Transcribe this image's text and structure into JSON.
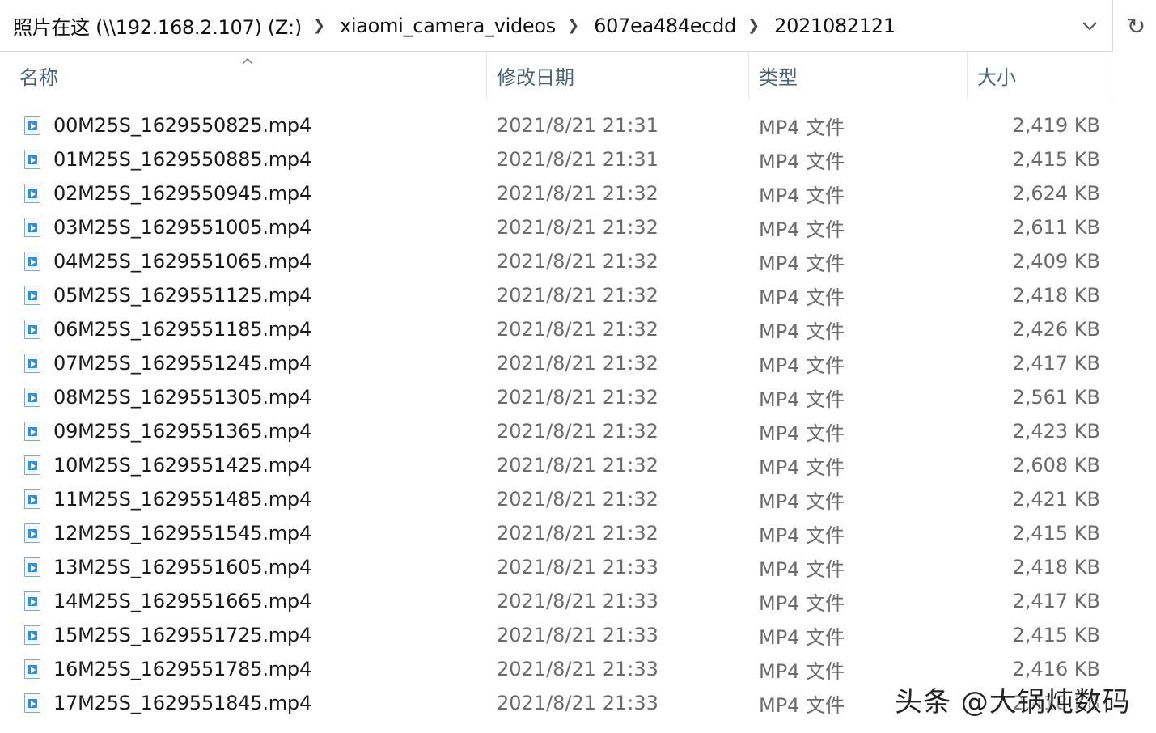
{
  "address_bar": {
    "breadcrumbs": [
      "照片在这 (\\\\192.168.2.107) (Z:)",
      "xiaomi_camera_videos",
      "607ea484ecdd",
      "2021082121"
    ],
    "dropdown_icon": "chevron-down-icon",
    "refresh_icon": "refresh-icon"
  },
  "columns": {
    "name": "名称",
    "date": "修改日期",
    "type": "类型",
    "size": "大小"
  },
  "files": [
    {
      "name": "00M25S_1629550825.mp4",
      "date": "2021/8/21 21:31",
      "type": "MP4 文件",
      "size": "2,419 KB"
    },
    {
      "name": "01M25S_1629550885.mp4",
      "date": "2021/8/21 21:31",
      "type": "MP4 文件",
      "size": "2,415 KB"
    },
    {
      "name": "02M25S_1629550945.mp4",
      "date": "2021/8/21 21:32",
      "type": "MP4 文件",
      "size": "2,624 KB"
    },
    {
      "name": "03M25S_1629551005.mp4",
      "date": "2021/8/21 21:32",
      "type": "MP4 文件",
      "size": "2,611 KB"
    },
    {
      "name": "04M25S_1629551065.mp4",
      "date": "2021/8/21 21:32",
      "type": "MP4 文件",
      "size": "2,409 KB"
    },
    {
      "name": "05M25S_1629551125.mp4",
      "date": "2021/8/21 21:32",
      "type": "MP4 文件",
      "size": "2,418 KB"
    },
    {
      "name": "06M25S_1629551185.mp4",
      "date": "2021/8/21 21:32",
      "type": "MP4 文件",
      "size": "2,426 KB"
    },
    {
      "name": "07M25S_1629551245.mp4",
      "date": "2021/8/21 21:32",
      "type": "MP4 文件",
      "size": "2,417 KB"
    },
    {
      "name": "08M25S_1629551305.mp4",
      "date": "2021/8/21 21:32",
      "type": "MP4 文件",
      "size": "2,561 KB"
    },
    {
      "name": "09M25S_1629551365.mp4",
      "date": "2021/8/21 21:32",
      "type": "MP4 文件",
      "size": "2,423 KB"
    },
    {
      "name": "10M25S_1629551425.mp4",
      "date": "2021/8/21 21:32",
      "type": "MP4 文件",
      "size": "2,608 KB"
    },
    {
      "name": "11M25S_1629551485.mp4",
      "date": "2021/8/21 21:32",
      "type": "MP4 文件",
      "size": "2,421 KB"
    },
    {
      "name": "12M25S_1629551545.mp4",
      "date": "2021/8/21 21:32",
      "type": "MP4 文件",
      "size": "2,415 KB"
    },
    {
      "name": "13M25S_1629551605.mp4",
      "date": "2021/8/21 21:33",
      "type": "MP4 文件",
      "size": "2,418 KB"
    },
    {
      "name": "14M25S_1629551665.mp4",
      "date": "2021/8/21 21:33",
      "type": "MP4 文件",
      "size": "2,417 KB"
    },
    {
      "name": "15M25S_1629551725.mp4",
      "date": "2021/8/21 21:33",
      "type": "MP4 文件",
      "size": "2,415 KB"
    },
    {
      "name": "16M25S_1629551785.mp4",
      "date": "2021/8/21 21:33",
      "type": "MP4 文件",
      "size": "2,416 KB"
    },
    {
      "name": "17M25S_1629551845.mp4",
      "date": "2021/8/21 21:33",
      "type": "MP4 文件",
      "size": "2,418 KB"
    }
  ],
  "watermark": "头条 @大锅炖数码"
}
